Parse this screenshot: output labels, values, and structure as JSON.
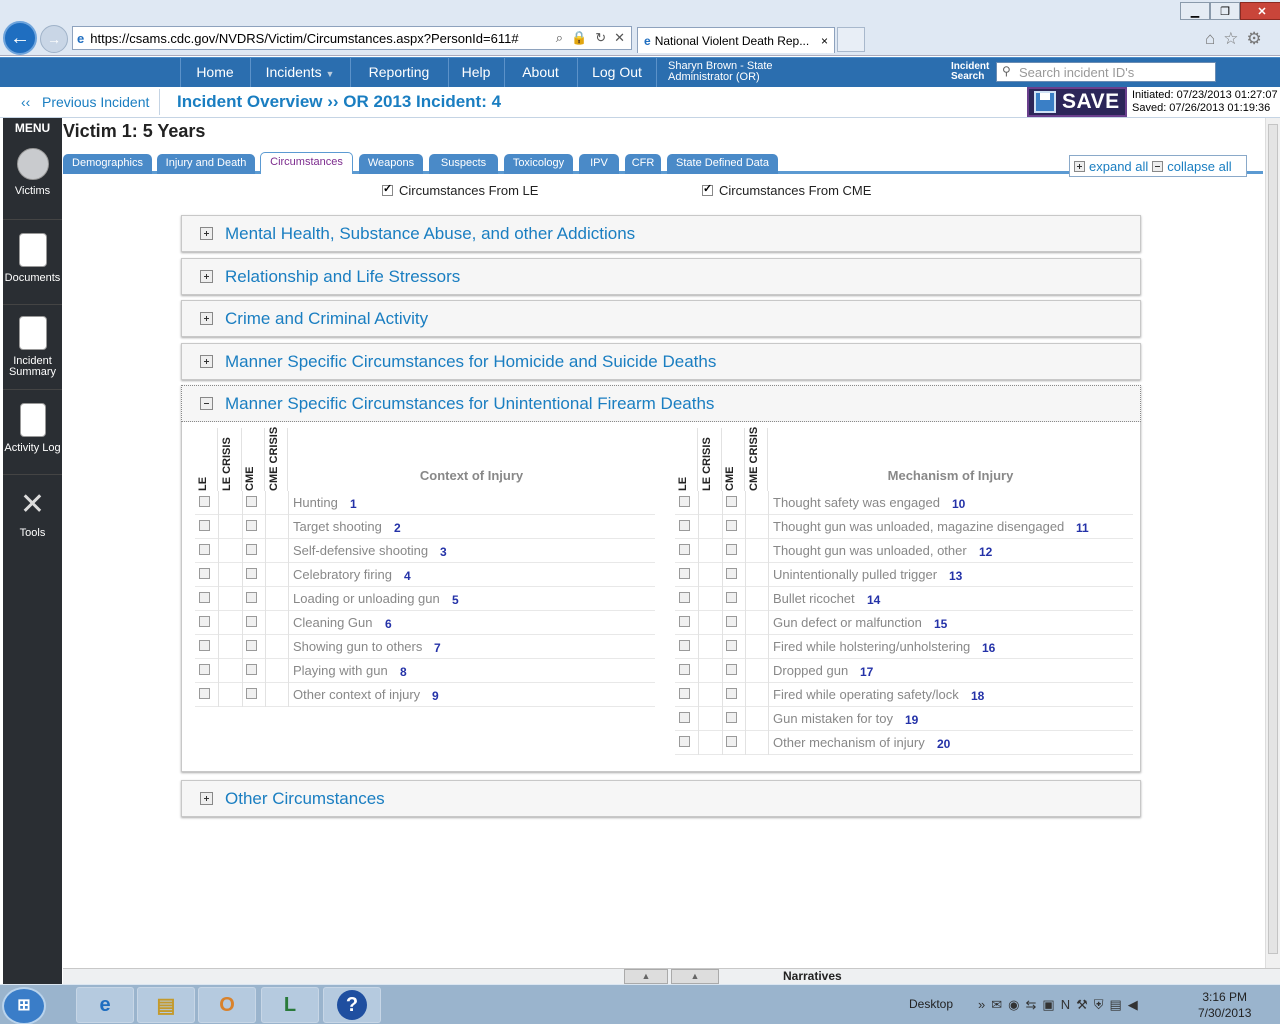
{
  "browser": {
    "url": "https://csams.cdc.gov/NVDRS/Victim/Circumstances.aspx?PersonId=611#",
    "tab_title": "National Violent Death Rep...",
    "tab_close": "×"
  },
  "topnav": {
    "items": [
      "Home",
      "Incidents",
      "Reporting",
      "Help",
      "About",
      "Log Out"
    ],
    "user_line1": "Sharyn Brown - State",
    "user_line2": "Administrator (OR)",
    "incident_search_line1": "Incident",
    "incident_search_line2": "Search",
    "search_placeholder": "Search incident ID's"
  },
  "subbar": {
    "prev_arrow": "‹‹",
    "prev_label": "Previous Incident",
    "overview": "Incident Overview ›› OR 2013 Incident: 4",
    "save_label": "SAVE",
    "initiated": "Initiated: 07/23/2013 01:27:07",
    "saved": "Saved: 07/26/2013 01:19:36"
  },
  "sidebar": {
    "title": "MENU",
    "items": [
      {
        "label": "Victims",
        "icon": "people-icon"
      },
      {
        "label": "Documents",
        "icon": "documents-icon"
      },
      {
        "label": "Incident Summary",
        "icon": "magnifier-document-icon"
      },
      {
        "label": "Activity Log",
        "icon": "clipboard-icon"
      },
      {
        "label": "Tools",
        "icon": "tools-icon"
      }
    ]
  },
  "victim_title": "Victim 1: 5 Years",
  "tabs": [
    "Demographics",
    "Injury and Death",
    "Circumstances",
    "Weapons",
    "Suspects",
    "Toxicology",
    "IPV",
    "CFR",
    "State Defined Data"
  ],
  "active_tab": "Circumstances",
  "expand_all": "expand all",
  "collapse_all": "collapse all",
  "filters": {
    "le": {
      "label": "Circumstances From LE",
      "checked": true
    },
    "cme": {
      "label": "Circumstances From CME",
      "checked": true
    }
  },
  "sections": [
    {
      "title": "Mental Health, Substance Abuse, and other Addictions",
      "expanded": false
    },
    {
      "title": "Relationship and Life Stressors",
      "expanded": false
    },
    {
      "title": "Crime and Criminal Activity",
      "expanded": false
    },
    {
      "title": "Manner Specific Circumstances for Homicide and Suicide Deaths",
      "expanded": false
    },
    {
      "title": "Manner Specific Circumstances for Unintentional Firearm Deaths",
      "expanded": true
    },
    {
      "title": "Other Circumstances",
      "expanded": false
    }
  ],
  "grid_headers": {
    "le": "LE",
    "le_crisis": "LE CRISIS",
    "cme": "CME",
    "cme_crisis": "CME CRISIS"
  },
  "context": {
    "title": "Context of Injury",
    "rows": [
      {
        "label": "Hunting",
        "num": "1"
      },
      {
        "label": "Target shooting",
        "num": "2"
      },
      {
        "label": "Self-defensive shooting",
        "num": "3"
      },
      {
        "label": "Celebratory firing",
        "num": "4"
      },
      {
        "label": "Loading or unloading gun",
        "num": "5"
      },
      {
        "label": "Cleaning Gun",
        "num": "6"
      },
      {
        "label": "Showing gun to others",
        "num": "7"
      },
      {
        "label": "Playing with gun",
        "num": "8"
      },
      {
        "label": "Other context of injury",
        "num": "9"
      }
    ]
  },
  "mechanism": {
    "title": "Mechanism of Injury",
    "rows": [
      {
        "label": "Thought safety was engaged",
        "num": "10"
      },
      {
        "label": "Thought gun was unloaded, magazine disengaged",
        "num": "11"
      },
      {
        "label": "Thought gun was unloaded, other",
        "num": "12"
      },
      {
        "label": "Unintentionally pulled trigger",
        "num": "13"
      },
      {
        "label": "Bullet ricochet",
        "num": "14"
      },
      {
        "label": "Gun defect or malfunction",
        "num": "15"
      },
      {
        "label": "Fired while holstering/unholstering",
        "num": "16"
      },
      {
        "label": "Dropped gun",
        "num": "17"
      },
      {
        "label": "Fired while operating safety/lock",
        "num": "18"
      },
      {
        "label": "Gun mistaken for toy",
        "num": "19"
      },
      {
        "label": "Other mechanism of injury",
        "num": "20"
      }
    ]
  },
  "bottom": {
    "narratives": "Narratives"
  },
  "taskbar": {
    "tray_desktop": "Desktop",
    "time": "3:16 PM",
    "date": "7/30/2013"
  }
}
